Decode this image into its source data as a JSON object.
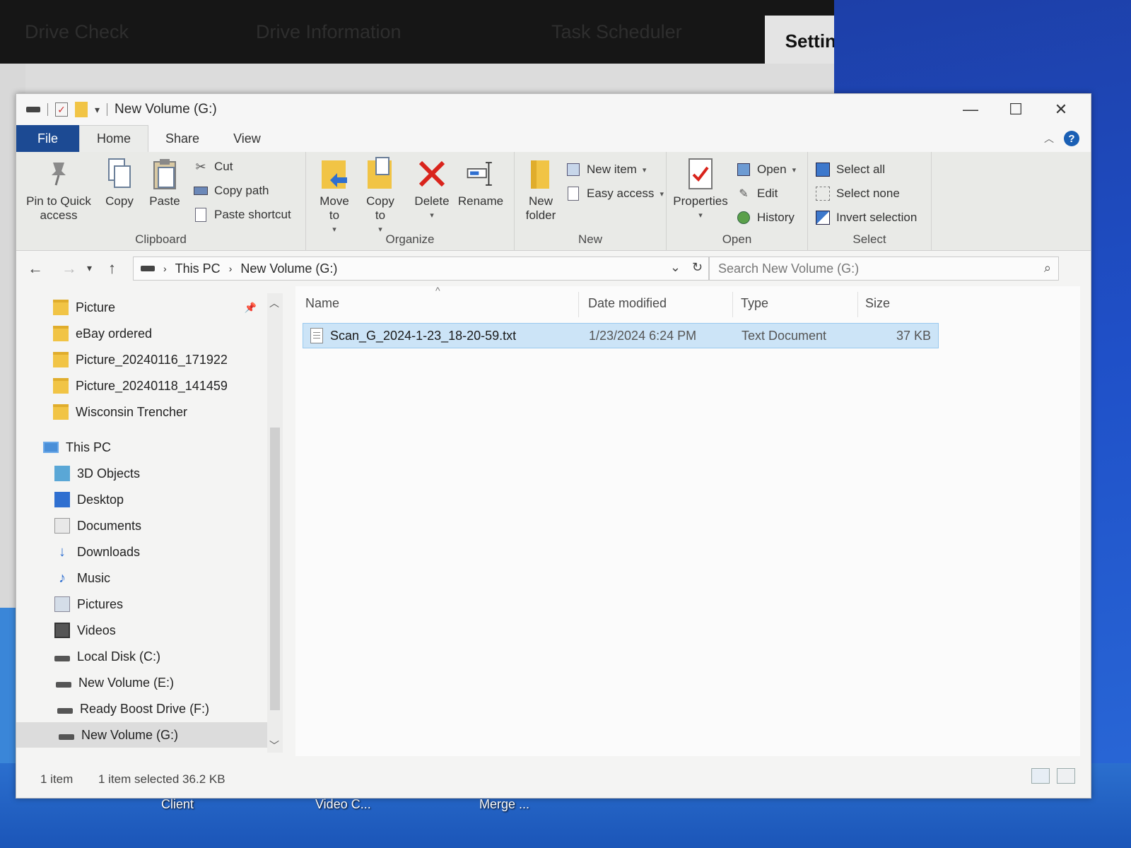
{
  "background_app": {
    "tabs": [
      "Drive Check",
      "Drive Information",
      "Task Scheduler"
    ],
    "active_tab": "Settings"
  },
  "desktop_icons": [
    "Client",
    "Video C...",
    "Merge ..."
  ],
  "window": {
    "title": "New Volume (G:)",
    "controls": {
      "minimize": "—",
      "maximize": "☐",
      "close": "✕"
    }
  },
  "ribbon_tabs": {
    "file": "File",
    "home": "Home",
    "share": "Share",
    "view": "View"
  },
  "ribbon": {
    "clipboard": {
      "label": "Clipboard",
      "pin": "Pin to Quick access",
      "copy": "Copy",
      "paste": "Paste",
      "cut": "Cut",
      "copy_path": "Copy path",
      "paste_shortcut": "Paste shortcut"
    },
    "organize": {
      "label": "Organize",
      "move_to": "Move to",
      "copy_to": "Copy to",
      "delete": "Delete",
      "rename": "Rename"
    },
    "new": {
      "label": "New",
      "new_folder": "New folder",
      "new_item": "New item",
      "easy_access": "Easy access"
    },
    "open": {
      "label": "Open",
      "properties": "Properties",
      "open": "Open",
      "edit": "Edit",
      "history": "History"
    },
    "select": {
      "label": "Select",
      "select_all": "Select all",
      "select_none": "Select none",
      "invert": "Invert selection"
    }
  },
  "address": {
    "path": [
      "This PC",
      "New Volume (G:)"
    ],
    "search_placeholder": "Search New Volume (G:)"
  },
  "nav_pane": {
    "quick_access": [
      "Picture",
      "eBay ordered",
      "Picture_20240116_171922",
      "Picture_20240118_141459",
      "Wisconsin Trencher"
    ],
    "this_pc": "This PC",
    "pc_items": [
      "3D Objects",
      "Desktop",
      "Documents",
      "Downloads",
      "Music",
      "Pictures",
      "Videos",
      "Local Disk (C:)",
      "New Volume (E:)",
      "Ready Boost Drive (F:)",
      "New Volume (G:)"
    ]
  },
  "columns": {
    "name": "Name",
    "date": "Date modified",
    "type": "Type",
    "size": "Size"
  },
  "files": [
    {
      "name": "Scan_G_2024-1-23_18-20-59.txt",
      "date": "1/23/2024 6:24 PM",
      "type": "Text Document",
      "size": "37 KB"
    }
  ],
  "status": {
    "count": "1 item",
    "selected": "1 item selected  36.2 KB"
  },
  "colors": {
    "file_tab": "#1c4a93",
    "selection": "#cce4f7",
    "folder": "#f1c445",
    "delete_x": "#d9241c"
  }
}
